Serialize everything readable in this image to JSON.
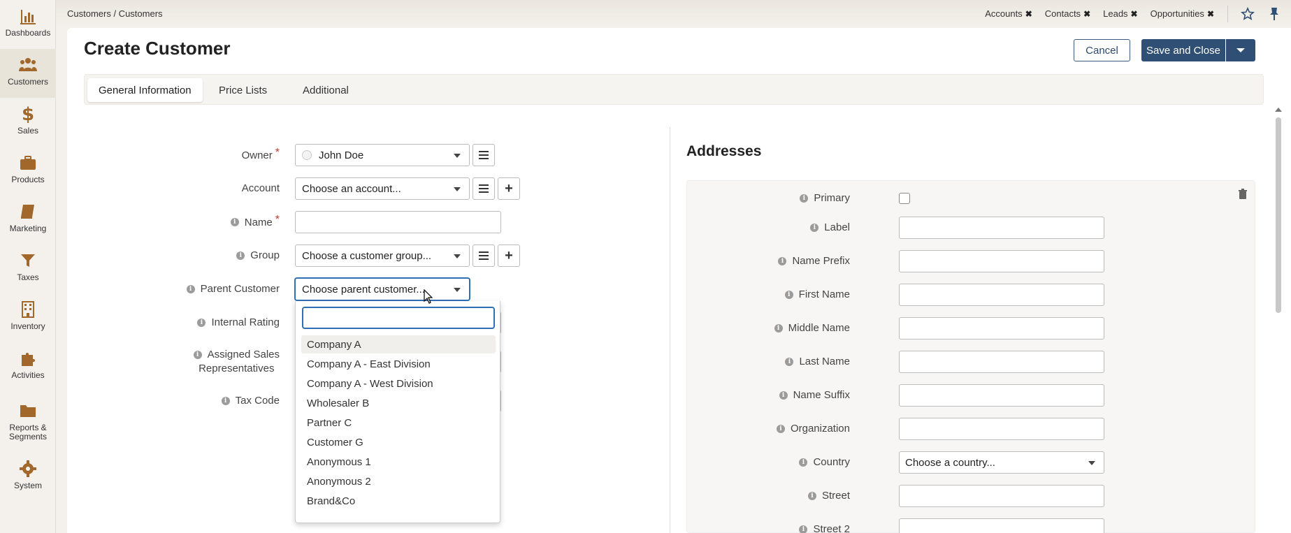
{
  "sidebar": {
    "items": [
      {
        "label": "Dashboards",
        "icon": "bar-chart-icon"
      },
      {
        "label": "Customers",
        "icon": "users-icon",
        "active": true
      },
      {
        "label": "Sales",
        "icon": "dollar-icon"
      },
      {
        "label": "Products",
        "icon": "briefcase-icon"
      },
      {
        "label": "Marketing",
        "icon": "book-icon"
      },
      {
        "label": "Taxes",
        "icon": "filter-icon"
      },
      {
        "label": "Inventory",
        "icon": "building-icon"
      },
      {
        "label": "Activities",
        "icon": "puzzle-icon"
      },
      {
        "label": "Reports &\nSegments",
        "icon": "folder-icon"
      },
      {
        "label": "System",
        "icon": "gear-icon"
      }
    ]
  },
  "topbar": {
    "breadcrumb": "Customers / Customers",
    "pinned": [
      "Accounts",
      "Contacts",
      "Leads",
      "Opportunities"
    ],
    "close_glyph": "✖"
  },
  "page": {
    "title": "Create Customer",
    "cancel_label": "Cancel",
    "save_label": "Save and Close"
  },
  "tabs": [
    "General Information",
    "Price Lists",
    "Additional"
  ],
  "form": {
    "owner": {
      "label": "Owner",
      "value": "John Doe"
    },
    "account": {
      "label": "Account",
      "placeholder": "Choose an account..."
    },
    "name": {
      "label": "Name"
    },
    "group": {
      "label": "Group",
      "placeholder": "Choose a customer group..."
    },
    "parent": {
      "label": "Parent Customer",
      "placeholder": "Choose parent customer..."
    },
    "rating": {
      "label": "Internal Rating"
    },
    "reps": {
      "label_line1": "Assigned Sales",
      "label_line2": "Representatives"
    },
    "tax": {
      "label": "Tax Code"
    }
  },
  "dropdown": {
    "options": [
      "Company A",
      "Company A - East Division",
      "Company A - West Division",
      "Wholesaler B",
      "Partner C",
      "Customer G",
      "Anonymous 1",
      "Anonymous 2",
      "Brand&Co"
    ]
  },
  "addresses": {
    "title": "Addresses",
    "fields": {
      "primary": "Primary",
      "label": "Label",
      "prefix": "Name Prefix",
      "first": "First Name",
      "middle": "Middle Name",
      "last": "Last Name",
      "suffix": "Name Suffix",
      "org": "Organization",
      "country": "Country",
      "country_placeholder": "Choose a country...",
      "street": "Street",
      "street2": "Street 2"
    }
  },
  "info_glyph": "i",
  "required_glyph": "*",
  "colors": {
    "accent": "#a2672b",
    "primary_button": "#2f4f74",
    "focus": "#2f6fb5"
  }
}
